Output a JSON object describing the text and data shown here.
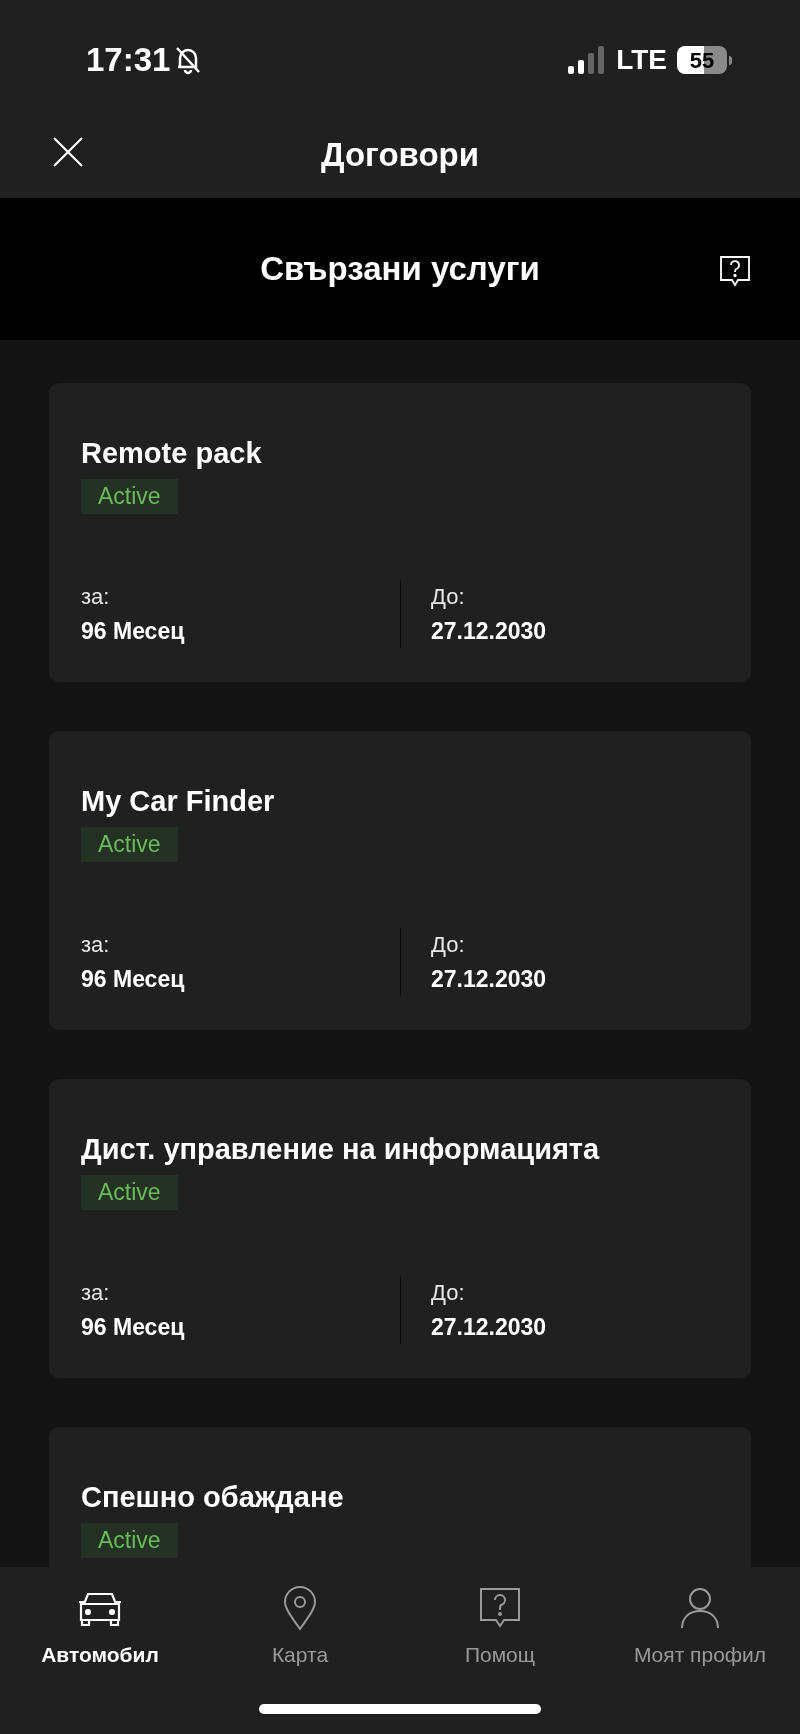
{
  "status_bar": {
    "time": "17:31",
    "network": "LTE",
    "battery": "55"
  },
  "header": {
    "title": "Договори"
  },
  "section": {
    "title": "Свързани услуги"
  },
  "services": [
    {
      "name": "Remote pack",
      "status": "Active",
      "for_label": "за:",
      "for_value": "96 Месец",
      "until_label": "До:",
      "until_value": "27.12.2030"
    },
    {
      "name": "My Car Finder",
      "status": "Active",
      "for_label": "за:",
      "for_value": "96 Месец",
      "until_label": "До:",
      "until_value": "27.12.2030"
    },
    {
      "name": "Дист. управление на информацията",
      "status": "Active",
      "for_label": "за:",
      "for_value": "96 Месец",
      "until_label": "До:",
      "until_value": "27.12.2030"
    },
    {
      "name": "Спешно обаждане",
      "status": "Active"
    }
  ],
  "tab_bar": [
    {
      "kind": "car",
      "label": "Автомобил",
      "selected": true
    },
    {
      "kind": "map",
      "label": "Карта",
      "selected": false
    },
    {
      "kind": "help",
      "label": "Помощ",
      "selected": false
    },
    {
      "kind": "profile",
      "label": "Моят профил",
      "selected": false
    }
  ]
}
